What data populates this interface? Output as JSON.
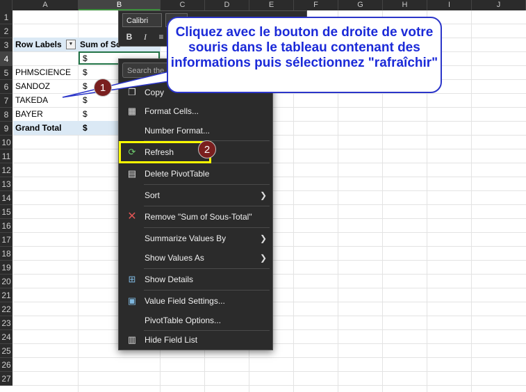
{
  "columns": [
    "A",
    "B",
    "C",
    "D",
    "E",
    "F",
    "G",
    "H",
    "I",
    "J"
  ],
  "rows": [
    "1",
    "2",
    "3",
    "4",
    "5",
    "6",
    "7",
    "8",
    "9",
    "10",
    "11",
    "12",
    "13",
    "14",
    "15",
    "16",
    "17",
    "18",
    "19",
    "20",
    "21",
    "22",
    "23",
    "24",
    "25",
    "26",
    "27"
  ],
  "pivot": {
    "header_row_labels": "Row Labels",
    "header_values": "Sum of So",
    "rows": [
      {
        "label": "",
        "value": "$"
      },
      {
        "label": "PHMSCIENCE",
        "value": "$"
      },
      {
        "label": "SANDOZ",
        "value": "$"
      },
      {
        "label": "TAKEDA",
        "value": "$"
      },
      {
        "label": "BAYER",
        "value": "$"
      }
    ],
    "grand_total_label": "Grand Total",
    "grand_total_value": "$"
  },
  "minibar": {
    "font_name": "Calibri",
    "buttons": [
      "B",
      "I",
      "≡"
    ]
  },
  "context_menu": {
    "search_placeholder": "Search the",
    "items": [
      {
        "label": "Copy",
        "icon": "copy-icon",
        "has_submenu": false
      },
      {
        "label": "Format Cells...",
        "icon": "format-cells-icon",
        "has_submenu": false
      },
      {
        "label": "Number Format...",
        "icon": "",
        "has_submenu": false
      },
      {
        "label": "Refresh",
        "icon": "refresh-icon",
        "has_submenu": false
      },
      {
        "label": "Delete PivotTable",
        "icon": "delete-pivot-icon",
        "has_submenu": false
      },
      {
        "label": "Sort",
        "icon": "",
        "has_submenu": true
      },
      {
        "label": "Remove \"Sum of Sous-Total\"",
        "icon": "remove-x-icon",
        "has_submenu": false
      },
      {
        "label": "Summarize Values By",
        "icon": "",
        "has_submenu": true
      },
      {
        "label": "Show Values As",
        "icon": "",
        "has_submenu": true
      },
      {
        "label": "Show Details",
        "icon": "show-details-icon",
        "has_submenu": false
      },
      {
        "label": "Value Field Settings...",
        "icon": "value-field-settings-icon",
        "has_submenu": false
      },
      {
        "label": "PivotTable Options...",
        "icon": "",
        "has_submenu": false
      },
      {
        "label": "Hide Field List",
        "icon": "field-list-icon",
        "has_submenu": false
      }
    ]
  },
  "annotations": {
    "callout_text": "Cliquez avec le bouton de droite de votre souris dans le tableau contenant des informations puis sélectionnez \"rafraîchir\"",
    "badge_1": "1",
    "badge_2": "2"
  },
  "colors": {
    "callout_text": "#1b2ad8",
    "callout_border": "#2b35c9",
    "highlight": "#ffff00",
    "badge": "#7a1f1f",
    "pivot_header": "#dbe9f5",
    "menu_bg": "#2b2b2b"
  }
}
